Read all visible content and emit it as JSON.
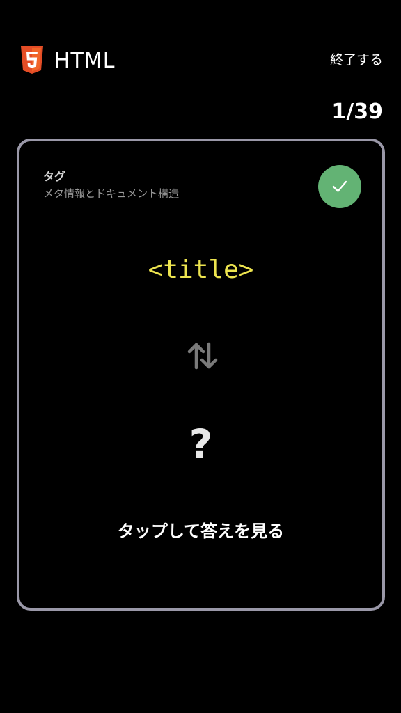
{
  "header": {
    "logo_icon": "html5-logo-icon",
    "title": "HTML",
    "end_label": "終了する"
  },
  "progress": {
    "text": "1/39",
    "current": 1,
    "total": 39
  },
  "card": {
    "category": "タグ",
    "subcategory": "メタ情報とドキュメント構造",
    "term": "<title>",
    "status_icon": "check-icon",
    "swap_icon": "swap-vertical-icon",
    "question_mark": "?",
    "tap_hint": "タップして答えを見る"
  },
  "colors": {
    "background": "#000000",
    "card_border": "#9a98a8",
    "term": "#ede44f",
    "check_badge": "#63b374",
    "html5_orange": "#e44d26"
  }
}
